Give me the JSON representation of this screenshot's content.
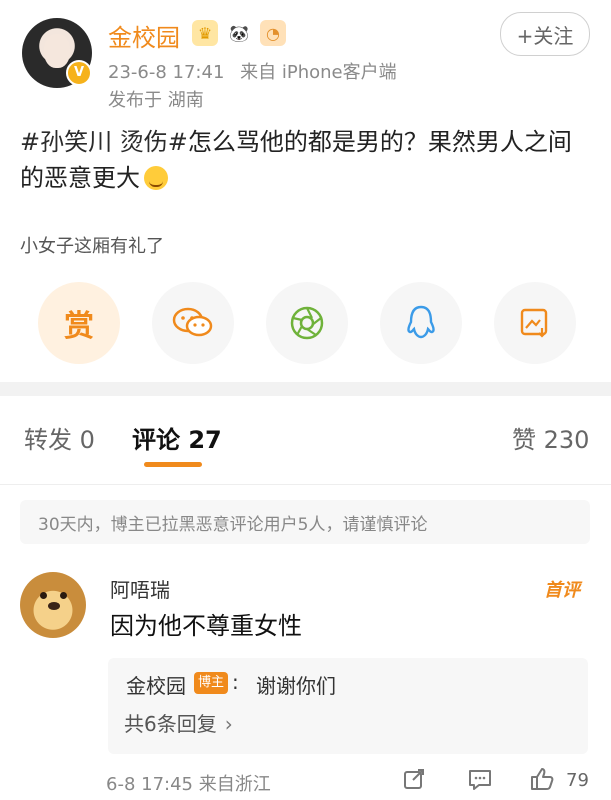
{
  "post": {
    "user_name": "金校园",
    "time": "23-6-8 17:41",
    "source": "来自 iPhone客户端",
    "location": "发布于 湖南",
    "follow_label": "+关注",
    "text_topic": "#孙笑川 烫伤#",
    "text_body": "怎么骂他的都是男的？果然男人之间的恶意更大",
    "signature": "小女子这厢有礼了"
  },
  "share": {
    "reward_label": "赏"
  },
  "tabs": {
    "repost": "转发 0",
    "comments": "评论 27",
    "likes": "赞 230"
  },
  "notice": "30天内，博主已拉黑恶意评论用户5人，请谨慎评论",
  "comment": {
    "author": "阿唔瑞",
    "top_badge": "首评",
    "text": "因为他不尊重女性",
    "reply_author": "金校园",
    "blogger_tag": "博主",
    "reply_colon": ":",
    "reply_text": "谢谢你们",
    "reply_more": "共6条回复",
    "time_location": "6-8 17:45  来自浙江",
    "like_count": "79"
  },
  "colors": {
    "accent": "#f08a1c",
    "muted": "#8a8a8a",
    "band": "#f2f2f2"
  }
}
